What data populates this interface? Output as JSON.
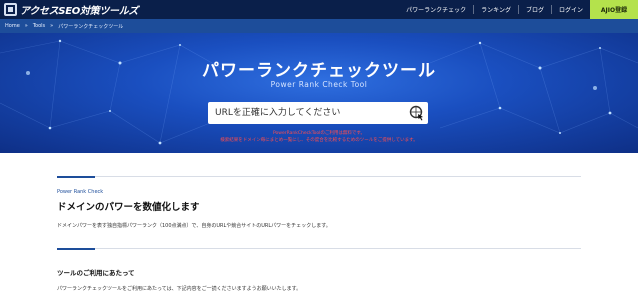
{
  "header": {
    "logo_text": "アクセスSEO対策ツールズ",
    "nav": [
      {
        "label": "パワーランクチェック"
      },
      {
        "label": "ランキング"
      },
      {
        "label": "ブログ"
      },
      {
        "label": "ログイン"
      }
    ],
    "cta_label": "AJIO登録",
    "cta_color": "#b4e24c",
    "bg_color": "#0a1f4a"
  },
  "breadcrumb": {
    "items": [
      "Home",
      "Tools",
      "パワーランクチェックツール"
    ],
    "separator": "»"
  },
  "hero": {
    "title": "パワーランクチェックツール",
    "subtitle": "Power Rank Check Tool",
    "search_placeholder": "URLを正確に入力してください",
    "notice_1": "PowerRankCheckToolのご利用は無料です。",
    "notice_2": "検索結果をドメイン毎にまとめ一覧にし、その度合を比較するためのツールをご提供しています。"
  },
  "intro": {
    "eyebrow": "Power Rank Check",
    "heading": "ドメインのパワーを数値化します",
    "text": "ドメインパワーを表す独自指標パワーランク（100点満点）で、自身のURLや競合サイトのURLパワーをチェックします。"
  },
  "usage": {
    "heading": "ツールのご利用にあたって",
    "text": "パワーランクチェックツールをご利用にあたっては、下記内容をご一読くださいますようお願いいたします。"
  },
  "colors": {
    "accent": "#1d4d9a",
    "hero": "#1a4fc0",
    "notice": "#ff4d4d"
  }
}
